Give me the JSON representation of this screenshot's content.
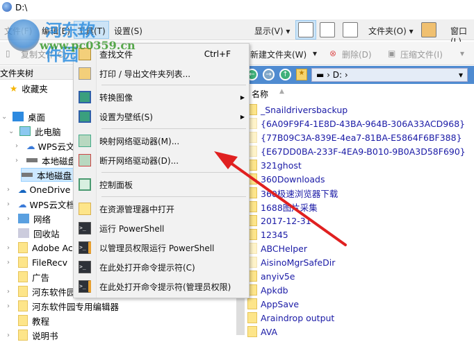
{
  "window": {
    "title": "D:\\"
  },
  "watermark": {
    "name": "河东软件园",
    "url": "www.pc0359.cn"
  },
  "menubar": {
    "items": [
      "文件(F)",
      "编辑(E)",
      "工具(T)",
      "设置(S)"
    ],
    "display": "显示(V)",
    "folder": "文件夹(O)",
    "window": "窗口(L)"
  },
  "toolbar": {
    "copy": "复制文件(C)",
    "new_folder": "新建文件夹(W)",
    "delete": "删除(D)",
    "compress": "压缩文件(I)"
  },
  "tree": {
    "header": "文件夹树",
    "items": [
      {
        "label": "收藏夹"
      },
      {
        "label": "桌面"
      },
      {
        "label": "此电脑"
      },
      {
        "label": "WPS云文档"
      },
      {
        "label": "本地磁盘"
      },
      {
        "label": "本地磁盘"
      },
      {
        "label": "OneDrive"
      },
      {
        "label": "WPS云文档"
      },
      {
        "label": "网络"
      },
      {
        "label": "回收站"
      },
      {
        "label": "Adobe Acrobat"
      },
      {
        "label": "FileRecv"
      },
      {
        "label": "广告"
      },
      {
        "label": "河东软件园"
      },
      {
        "label": "河东软件园专用编辑器"
      },
      {
        "label": "教程"
      },
      {
        "label": "说明书"
      }
    ]
  },
  "address": {
    "drive": "D:"
  },
  "list": {
    "column": "名称",
    "items": [
      "_Snaildriversbackup",
      "{6A09F9F4-1E8D-43BA-964B-306A33ACD968}",
      "{77B09C3A-839E-4ea7-81BA-E5864F6BF388}",
      "{E67DD0BA-233F-4EA9-B010-9B0A3D58F690}",
      "321ghost",
      "360Downloads",
      "360极速浏览器下载",
      "1688图片采集",
      "2017-12-31",
      "12345",
      "ABCHelper",
      "AisinoMgrSafeDir",
      "anyiv5e",
      "Apkdb",
      "AppSave",
      "Araindrop output",
      "AVA"
    ]
  },
  "tools_menu": {
    "items": [
      {
        "label": "查找文件",
        "shortcut": "Ctrl+F"
      },
      {
        "label": "打印 / 导出文件夹列表..."
      },
      {
        "label": "转换图像"
      },
      {
        "label": "设置为壁纸(S)"
      },
      {
        "label": "映射网络驱动器(M)..."
      },
      {
        "label": "断开网络驱动器(D)..."
      },
      {
        "label": "控制面板"
      },
      {
        "label": "在资源管理器中打开"
      },
      {
        "label": "运行 PowerShell"
      },
      {
        "label": "以管理员权限运行 PowerShell"
      },
      {
        "label": "在此处打开命令提示符(C)"
      },
      {
        "label": "在此处打开命令提示符(管理员权限)"
      }
    ]
  },
  "colors": {
    "accent": "#4f8bd1",
    "arrow": "#e02020",
    "link": "#1a1aa6"
  }
}
